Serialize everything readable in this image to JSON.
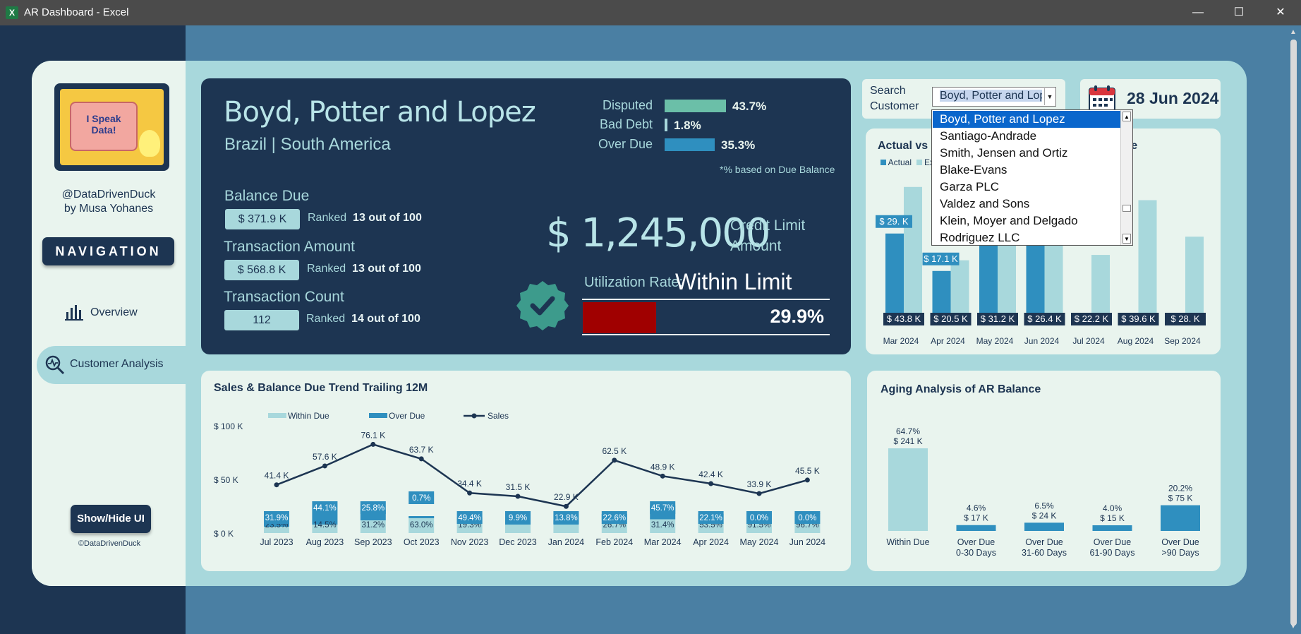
{
  "window": {
    "title": "AR Dashboard - Excel",
    "app_icon": "X",
    "minimize": "—",
    "maximize": "☐",
    "close": "✕"
  },
  "sidebar": {
    "handle_line1": "@DataDrivenDuck",
    "handle_line2": "by Musa Yohanes",
    "logo_text_1": "I Speak",
    "logo_text_2": "Data!",
    "navigation_label": "NAVIGATION",
    "items": [
      {
        "label": "Overview",
        "icon": "bar-chart-icon"
      },
      {
        "label": "Customer Analysis",
        "icon": "magnify-pulse-icon"
      }
    ],
    "showhide_label": "Show/Hide UI",
    "copyright": "©DataDrivenDuck"
  },
  "customer": {
    "name": "Boyd, Potter and Lopez",
    "location": "Brazil | South America",
    "balance_due_label": "Balance Due",
    "balance_due_value": "$ 371.9 K",
    "balance_due_rank_prefix": "Ranked",
    "balance_due_rank": "13 out of 100",
    "transaction_amount_label": "Transaction Amount",
    "transaction_amount_value": "$ 568.8 K",
    "transaction_amount_rank_prefix": "Ranked",
    "transaction_amount_rank": "13 out of 100",
    "transaction_count_label": "Transaction Count",
    "transaction_count_value": "112",
    "transaction_count_rank_prefix": "Ranked",
    "transaction_count_rank": "14 out of 100",
    "disputed_label": "Disputed",
    "disputed_value": "43.7%",
    "disputed_fraction": 0.437,
    "bad_debt_label": "Bad Debt",
    "bad_debt_value": "1.8%",
    "bad_debt_fraction": 0.018,
    "overdue_label": "Over Due",
    "overdue_value": "35.3%",
    "overdue_fraction": 0.353,
    "footnote": "*% based on Due Balance",
    "credit_limit_value": "$ 1,245,000",
    "credit_limit_label_1": "Credit Limit",
    "credit_limit_label_2": "Amount",
    "utilization_label": "Utilization Rate:",
    "utilization_status": "Within Limit",
    "utilization_pct": "29.9%",
    "utilization_fraction": 0.299,
    "colors": {
      "disputed": "#6bbfa8",
      "bad_debt": "#a8d8dc",
      "overdue": "#2f8fbf",
      "utilization": "#a00000",
      "check": "#3d9b8c"
    }
  },
  "search": {
    "label_1": "Search",
    "label_2": "Customer",
    "value": "Boyd, Potter and Lopez",
    "options": [
      "Boyd, Potter and Lopez",
      "Santiago-Andrade",
      "Smith, Jensen and Ortiz",
      "Blake-Evans",
      "Garza PLC",
      "Valdez and Sons",
      "Klein, Moyer and Delgado",
      "Rodriguez LLC"
    ]
  },
  "date": {
    "value": "28 Jun 2024"
  },
  "actual_chart": {
    "title_visible_start": "Actual vs",
    "title_visible_end": "ble",
    "legend_actual": "Actual",
    "legend_expected_partial": "Ex"
  },
  "trend_chart": {
    "title": "Sales & Balance Due Trend Trailing 12M"
  },
  "aging_chart": {
    "title": "Aging Analysis of AR Balance"
  },
  "chart_data": [
    {
      "type": "bar",
      "title": "Actual vs ... ble",
      "categories": [
        "Mar 2024",
        "Apr 2024",
        "May 2024",
        "Jun 2024",
        "Jul 2024",
        "Aug 2024",
        "Sep 2024"
      ],
      "series": [
        {
          "name": "Actual",
          "values": [
            29,
            17.1,
            40,
            40,
            null,
            null,
            null
          ],
          "labels": [
            "$ 29. K",
            "$ 17.1 K",
            "",
            "",
            "",
            "",
            ""
          ],
          "color": "#2f8fbf"
        },
        {
          "name": "Ex",
          "values": [
            43.8,
            20.5,
            31.2,
            26.4,
            22.2,
            39.6,
            28
          ],
          "labels": [
            "$ 43.8 K",
            "$ 20.5 K",
            "$ 31.2 K",
            "$ 26.4 K",
            "$ 22.2 K",
            "$ 39.6 K",
            "$ 28. K"
          ],
          "color": "#a8d8dc"
        }
      ],
      "ylim": [
        0,
        46
      ]
    },
    {
      "type": "bar",
      "title": "Sales & Balance Due Trend Trailing 12M",
      "categories": [
        "Jul 2023",
        "Aug 2023",
        "Sep 2023",
        "Oct 2023",
        "Nov 2023",
        "Dec 2023",
        "Jan 2024",
        "Feb 2024",
        "Mar 2024",
        "Apr 2024",
        "May 2024",
        "Jun 2024"
      ],
      "y_ticks": [
        "$ 100 K",
        "$ 50 K",
        "$ 0 K"
      ],
      "ylim": [
        0,
        100
      ],
      "series": [
        {
          "name": "Within Due",
          "values": [
            6,
            8,
            12,
            14,
            9,
            8,
            8,
            12,
            13,
            12,
            12,
            18
          ],
          "labels": [
            "23.5%",
            "14.5%",
            "31.2%",
            "63.0%",
            "19.3%",
            "",
            "",
            "26.7%",
            "31.4%",
            "53.5%",
            "91.5%",
            "96.7%"
          ],
          "color": "#a8d8dc"
        },
        {
          "name": "Over Due",
          "values": [
            4,
            10,
            10,
            2,
            6,
            4,
            4,
            6,
            13,
            6,
            1,
            1
          ],
          "labels": [
            "31.9%",
            "44.1%",
            "25.8%",
            "0.7%",
            "49.4%",
            "9.9%",
            "13.8%",
            "22.6%",
            "45.7%",
            "22.1%",
            "0.0%",
            "0.0%"
          ],
          "color": "#2f8fbf"
        },
        {
          "name": "Sales",
          "values": [
            41.4,
            57.6,
            76.1,
            63.7,
            34.4,
            31.5,
            22.9,
            62.5,
            48.9,
            42.4,
            33.9,
            45.5
          ],
          "labels": [
            "41.4 K",
            "57.6 K",
            "76.1 K",
            "63.7 K",
            "34.4 K",
            "31.5 K",
            "22.9 K",
            "62.5 K",
            "48.9 K",
            "42.4 K",
            "33.9 K",
            "45.5 K"
          ],
          "color": "#1d3552"
        }
      ]
    },
    {
      "type": "bar",
      "title": "Aging Analysis of AR Balance",
      "categories": [
        "Within Due",
        "Over Due 0-30 Days",
        "Over Due 31-60 Days",
        "Over Due 61-90 Days",
        "Over Due >90 Days"
      ],
      "category_lines": [
        [
          "Within Due"
        ],
        [
          "Over Due",
          "0-30 Days"
        ],
        [
          "Over Due",
          "31-60 Days"
        ],
        [
          "Over Due",
          "61-90 Days"
        ],
        [
          "Over Due",
          ">90 Days"
        ]
      ],
      "series": [
        {
          "name": "AR Balance",
          "values": [
            241,
            17,
            24,
            15,
            75
          ],
          "labels": [
            "$ 241 K",
            "$ 17 K",
            "$ 24 K",
            "$ 15 K",
            "$ 75 K"
          ],
          "pct_labels": [
            "64.7%",
            "4.6%",
            "6.5%",
            "4.0%",
            "20.2%"
          ],
          "colors": [
            "#a8d8dc",
            "#2f8fbf",
            "#2f8fbf",
            "#2f8fbf",
            "#2f8fbf"
          ]
        }
      ],
      "ylim": [
        0,
        260
      ]
    }
  ]
}
